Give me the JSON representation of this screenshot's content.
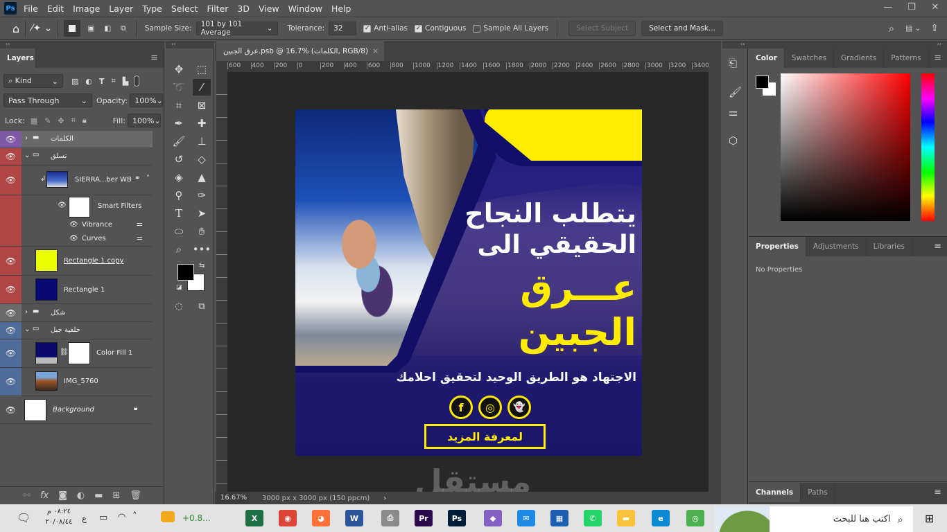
{
  "app": {
    "logo": "Ps",
    "menu": [
      "File",
      "Edit",
      "Image",
      "Layer",
      "Type",
      "Select",
      "Filter",
      "3D",
      "View",
      "Window",
      "Help"
    ],
    "window_controls": [
      "—",
      "❐",
      "✕"
    ]
  },
  "options": {
    "sample_size_label": "Sample Size:",
    "sample_size_value": "101 by 101 Average",
    "tolerance_label": "Tolerance:",
    "tolerance_value": "32",
    "anti_alias": "Anti-alias",
    "anti_alias_checked": true,
    "contiguous": "Contiguous",
    "contiguous_checked": true,
    "sample_all": "Sample All Layers",
    "sample_all_checked": false,
    "select_subject": "Select Subject",
    "select_mask": "Select and Mask..."
  },
  "layers_panel": {
    "tab": "Layers",
    "filter_kind": "Kind",
    "blend_mode": "Pass Through",
    "opacity_label": "Opacity:",
    "opacity": "100%",
    "lock_label": "Lock:",
    "fill_label": "Fill:",
    "fill": "100%",
    "layers": [
      {
        "name": "الكلمات",
        "type": "group",
        "color": "#7d59a6"
      },
      {
        "name": "تسلق",
        "type": "group",
        "color": "#b04545"
      },
      {
        "name": "SIERRA...ber WB",
        "type": "smart-object",
        "color": "#b04545"
      },
      {
        "name": "Smart Filters",
        "type": "filters",
        "color": "#b04545"
      },
      {
        "name": "Vibrance",
        "type": "filter",
        "color": "#b04545"
      },
      {
        "name": "Curves",
        "type": "filter",
        "color": "#b04545"
      },
      {
        "name": "Rectangle 1 copy",
        "type": "shape",
        "color": "#b04545"
      },
      {
        "name": "Rectangle 1",
        "type": "shape",
        "color": "#b04545"
      },
      {
        "name": "شكل",
        "type": "group",
        "color": "#6b6b6b"
      },
      {
        "name": "خلفية جبل",
        "type": "group",
        "color": "#4e6b9a"
      },
      {
        "name": "Color Fill 1",
        "type": "fill",
        "color": "#4e6b9a"
      },
      {
        "name": "IMG_5760",
        "type": "smart-object",
        "color": "#4e6b9a"
      },
      {
        "name": "Background",
        "type": "background",
        "color": "#535353"
      }
    ]
  },
  "document": {
    "tab_title": "عرق الجبين.psb @ 16.7% (الكلمات, RGB/8)",
    "zoom": "16.67%",
    "doc_info": "3000 px x 3000 px (150 ppcm)",
    "ruler_ticks": [
      "600",
      "400",
      "200",
      "0",
      "200",
      "400",
      "600",
      "800",
      "1000",
      "1200",
      "1400",
      "1600",
      "1800",
      "2000",
      "2200",
      "2400",
      "2600",
      "2800",
      "3000",
      "3200",
      "3400"
    ]
  },
  "artwork": {
    "line1": "يتطلب النجاح",
    "line2": "الحقيقي الى",
    "line3": "عـــرق",
    "line4": "الجبين",
    "tagline": "الاجتهاد هو الطريق الوحيد لتحقيق احلامك",
    "cta": "لمعرفة المزيد",
    "social": [
      "f",
      "◎",
      "👻"
    ],
    "navy": "#1c1773",
    "yellow": "#ffec00"
  },
  "color_panel": {
    "tabs": [
      "Color",
      "Swatches",
      "Gradients",
      "Patterns"
    ]
  },
  "properties_panel": {
    "tabs": [
      "Properties",
      "Adjustments",
      "Libraries"
    ],
    "content": "No Properties"
  },
  "channels_panel": {
    "tabs": [
      "Channels",
      "Paths"
    ]
  },
  "taskbar": {
    "time": "٠٨:٢٤ م",
    "date": "٢٠/٠٨/٤٤",
    "lang": "ع",
    "weather": "+0.8...",
    "search_placeholder": "اكتب هنا للبحث",
    "apps": [
      {
        "label": "X",
        "color": "#1d7044"
      },
      {
        "label": "◉",
        "color": "#db4437"
      },
      {
        "label": "◕",
        "color": "#ff7139"
      },
      {
        "label": "W",
        "color": "#2b579a"
      },
      {
        "label": "⎙",
        "color": "#8a8a8a"
      },
      {
        "label": "Pr",
        "color": "#2a0a4a"
      },
      {
        "label": "Ps",
        "color": "#001e36"
      },
      {
        "label": "◆",
        "color": "#8661c5"
      },
      {
        "label": "✉",
        "color": "#1e88e5"
      },
      {
        "label": "▦",
        "color": "#1c5fb0"
      },
      {
        "label": "✆",
        "color": "#25d366"
      },
      {
        "label": "▬",
        "color": "#f8c33a"
      },
      {
        "label": "e",
        "color": "#0c8ad6"
      },
      {
        "label": "◎",
        "color": "#4caf50"
      }
    ]
  },
  "watermark": "مستقل"
}
